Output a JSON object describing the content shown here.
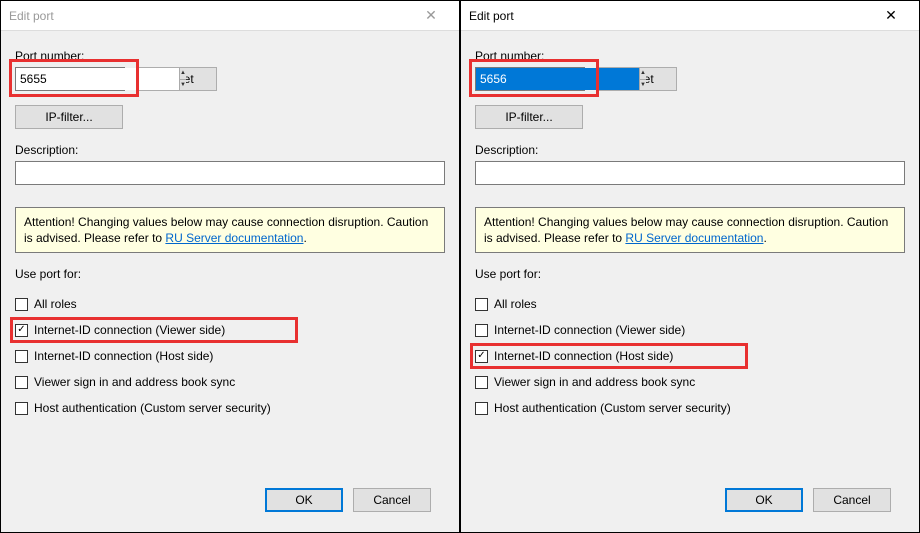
{
  "left": {
    "title": "Edit port",
    "port_label": "Port number:",
    "port_value": "5655",
    "reset": "Reset",
    "ipfilter": "IP-filter...",
    "description_label": "Description:",
    "description_value": "",
    "warn_pre": "Attention! Changing values below may cause connection disruption. Caution is advised. Please refer to ",
    "warn_link": "RU Server documentation",
    "warn_post": ".",
    "use_label": "Use port for:",
    "cb_all": "All roles",
    "cb_viewer": "Internet-ID connection (Viewer side)",
    "cb_host": "Internet-ID connection (Host side)",
    "cb_signin": "Viewer sign in and address book sync",
    "cb_auth": "Host authentication (Custom server security)",
    "ok": "OK",
    "cancel": "Cancel"
  },
  "right": {
    "title": "Edit port",
    "port_label": "Port number:",
    "port_value": "5656",
    "reset": "Reset",
    "ipfilter": "IP-filter...",
    "description_label": "Description:",
    "description_value": "",
    "warn_pre": "Attention! Changing values below may cause connection disruption. Caution is advised. Please refer to ",
    "warn_link": "RU Server documentation",
    "warn_post": ".",
    "use_label": "Use port for:",
    "cb_all": "All roles",
    "cb_viewer": "Internet-ID connection (Viewer side)",
    "cb_host": "Internet-ID connection (Host side)",
    "cb_signin": "Viewer sign in and address book sync",
    "cb_auth": "Host authentication (Custom server security)",
    "ok": "OK",
    "cancel": "Cancel"
  }
}
